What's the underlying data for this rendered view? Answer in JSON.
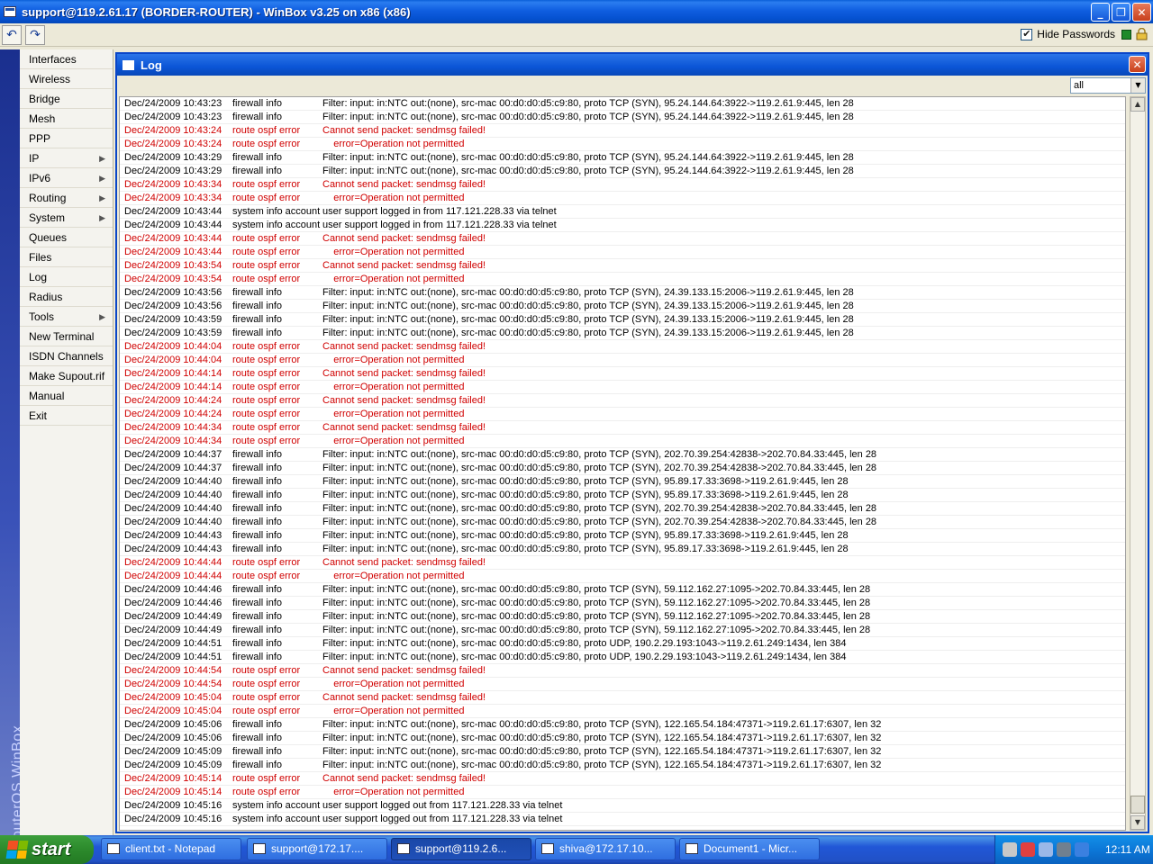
{
  "window": {
    "title": "support@119.2.61.17 (BORDER-ROUTER) - WinBox v3.25 on x86 (x86)"
  },
  "toolbar": {
    "hide_passwords_label": "Hide Passwords",
    "hide_passwords_checked": "✔"
  },
  "sidebar": {
    "brand": "RouterOS WinBox",
    "items": [
      {
        "label": "Interfaces",
        "arrow": ""
      },
      {
        "label": "Wireless",
        "arrow": ""
      },
      {
        "label": "Bridge",
        "arrow": ""
      },
      {
        "label": "Mesh",
        "arrow": ""
      },
      {
        "label": "PPP",
        "arrow": ""
      },
      {
        "label": "IP",
        "arrow": "▶"
      },
      {
        "label": "IPv6",
        "arrow": "▶"
      },
      {
        "label": "Routing",
        "arrow": "▶"
      },
      {
        "label": "System",
        "arrow": "▶"
      },
      {
        "label": "Queues",
        "arrow": ""
      },
      {
        "label": "Files",
        "arrow": ""
      },
      {
        "label": "Log",
        "arrow": ""
      },
      {
        "label": "Radius",
        "arrow": ""
      },
      {
        "label": "Tools",
        "arrow": "▶"
      },
      {
        "label": "New Terminal",
        "arrow": ""
      },
      {
        "label": "ISDN Channels",
        "arrow": ""
      },
      {
        "label": "Make Supout.rif",
        "arrow": ""
      },
      {
        "label": "Manual",
        "arrow": ""
      },
      {
        "label": "Exit",
        "arrow": ""
      }
    ]
  },
  "log_window": {
    "title": "Log",
    "filter_value": "all",
    "rows": [
      {
        "time": "Dec/24/2009 10:43:23",
        "topic": "firewall info",
        "msg": "Filter: input: in:NTC out:(none), src-mac 00:d0:d0:d5:c9:80, proto TCP (SYN), 95.24.144.64:3922->119.2.61.9:445, len 28",
        "err": false
      },
      {
        "time": "Dec/24/2009 10:43:23",
        "topic": "firewall info",
        "msg": "Filter: input: in:NTC out:(none), src-mac 00:d0:d0:d5:c9:80, proto TCP (SYN), 95.24.144.64:3922->119.2.61.9:445, len 28",
        "err": false
      },
      {
        "time": "Dec/24/2009 10:43:24",
        "topic": "route ospf error",
        "msg": "Cannot send packet: sendmsg failed!",
        "err": true
      },
      {
        "time": "Dec/24/2009 10:43:24",
        "topic": "route ospf error",
        "msg": "    error=Operation not permitted",
        "err": true
      },
      {
        "time": "Dec/24/2009 10:43:29",
        "topic": "firewall info",
        "msg": "Filter: input: in:NTC out:(none), src-mac 00:d0:d0:d5:c9:80, proto TCP (SYN), 95.24.144.64:3922->119.2.61.9:445, len 28",
        "err": false
      },
      {
        "time": "Dec/24/2009 10:43:29",
        "topic": "firewall info",
        "msg": "Filter: input: in:NTC out:(none), src-mac 00:d0:d0:d5:c9:80, proto TCP (SYN), 95.24.144.64:3922->119.2.61.9:445, len 28",
        "err": false
      },
      {
        "time": "Dec/24/2009 10:43:34",
        "topic": "route ospf error",
        "msg": "Cannot send packet: sendmsg failed!",
        "err": true
      },
      {
        "time": "Dec/24/2009 10:43:34",
        "topic": "route ospf error",
        "msg": "    error=Operation not permitted",
        "err": true
      },
      {
        "time": "Dec/24/2009 10:43:44",
        "topic": "system info account",
        "msg": "user support logged in from 117.121.228.33 via telnet",
        "err": false
      },
      {
        "time": "Dec/24/2009 10:43:44",
        "topic": "system info account",
        "msg": "user support logged in from 117.121.228.33 via telnet",
        "err": false
      },
      {
        "time": "Dec/24/2009 10:43:44",
        "topic": "route ospf error",
        "msg": "Cannot send packet: sendmsg failed!",
        "err": true
      },
      {
        "time": "Dec/24/2009 10:43:44",
        "topic": "route ospf error",
        "msg": "    error=Operation not permitted",
        "err": true
      },
      {
        "time": "Dec/24/2009 10:43:54",
        "topic": "route ospf error",
        "msg": "Cannot send packet: sendmsg failed!",
        "err": true
      },
      {
        "time": "Dec/24/2009 10:43:54",
        "topic": "route ospf error",
        "msg": "    error=Operation not permitted",
        "err": true
      },
      {
        "time": "Dec/24/2009 10:43:56",
        "topic": "firewall info",
        "msg": "Filter: input: in:NTC out:(none), src-mac 00:d0:d0:d5:c9:80, proto TCP (SYN), 24.39.133.15:2006->119.2.61.9:445, len 28",
        "err": false
      },
      {
        "time": "Dec/24/2009 10:43:56",
        "topic": "firewall info",
        "msg": "Filter: input: in:NTC out:(none), src-mac 00:d0:d0:d5:c9:80, proto TCP (SYN), 24.39.133.15:2006->119.2.61.9:445, len 28",
        "err": false
      },
      {
        "time": "Dec/24/2009 10:43:59",
        "topic": "firewall info",
        "msg": "Filter: input: in:NTC out:(none), src-mac 00:d0:d0:d5:c9:80, proto TCP (SYN), 24.39.133.15:2006->119.2.61.9:445, len 28",
        "err": false
      },
      {
        "time": "Dec/24/2009 10:43:59",
        "topic": "firewall info",
        "msg": "Filter: input: in:NTC out:(none), src-mac 00:d0:d0:d5:c9:80, proto TCP (SYN), 24.39.133.15:2006->119.2.61.9:445, len 28",
        "err": false
      },
      {
        "time": "Dec/24/2009 10:44:04",
        "topic": "route ospf error",
        "msg": "Cannot send packet: sendmsg failed!",
        "err": true
      },
      {
        "time": "Dec/24/2009 10:44:04",
        "topic": "route ospf error",
        "msg": "    error=Operation not permitted",
        "err": true
      },
      {
        "time": "Dec/24/2009 10:44:14",
        "topic": "route ospf error",
        "msg": "Cannot send packet: sendmsg failed!",
        "err": true
      },
      {
        "time": "Dec/24/2009 10:44:14",
        "topic": "route ospf error",
        "msg": "    error=Operation not permitted",
        "err": true
      },
      {
        "time": "Dec/24/2009 10:44:24",
        "topic": "route ospf error",
        "msg": "Cannot send packet: sendmsg failed!",
        "err": true
      },
      {
        "time": "Dec/24/2009 10:44:24",
        "topic": "route ospf error",
        "msg": "    error=Operation not permitted",
        "err": true
      },
      {
        "time": "Dec/24/2009 10:44:34",
        "topic": "route ospf error",
        "msg": "Cannot send packet: sendmsg failed!",
        "err": true
      },
      {
        "time": "Dec/24/2009 10:44:34",
        "topic": "route ospf error",
        "msg": "    error=Operation not permitted",
        "err": true
      },
      {
        "time": "Dec/24/2009 10:44:37",
        "topic": "firewall info",
        "msg": "Filter: input: in:NTC out:(none), src-mac 00:d0:d0:d5:c9:80, proto TCP (SYN), 202.70.39.254:42838->202.70.84.33:445, len 28",
        "err": false
      },
      {
        "time": "Dec/24/2009 10:44:37",
        "topic": "firewall info",
        "msg": "Filter: input: in:NTC out:(none), src-mac 00:d0:d0:d5:c9:80, proto TCP (SYN), 202.70.39.254:42838->202.70.84.33:445, len 28",
        "err": false
      },
      {
        "time": "Dec/24/2009 10:44:40",
        "topic": "firewall info",
        "msg": "Filter: input: in:NTC out:(none), src-mac 00:d0:d0:d5:c9:80, proto TCP (SYN), 95.89.17.33:3698->119.2.61.9:445, len 28",
        "err": false
      },
      {
        "time": "Dec/24/2009 10:44:40",
        "topic": "firewall info",
        "msg": "Filter: input: in:NTC out:(none), src-mac 00:d0:d0:d5:c9:80, proto TCP (SYN), 95.89.17.33:3698->119.2.61.9:445, len 28",
        "err": false
      },
      {
        "time": "Dec/24/2009 10:44:40",
        "topic": "firewall info",
        "msg": "Filter: input: in:NTC out:(none), src-mac 00:d0:d0:d5:c9:80, proto TCP (SYN), 202.70.39.254:42838->202.70.84.33:445, len 28",
        "err": false
      },
      {
        "time": "Dec/24/2009 10:44:40",
        "topic": "firewall info",
        "msg": "Filter: input: in:NTC out:(none), src-mac 00:d0:d0:d5:c9:80, proto TCP (SYN), 202.70.39.254:42838->202.70.84.33:445, len 28",
        "err": false
      },
      {
        "time": "Dec/24/2009 10:44:43",
        "topic": "firewall info",
        "msg": "Filter: input: in:NTC out:(none), src-mac 00:d0:d0:d5:c9:80, proto TCP (SYN), 95.89.17.33:3698->119.2.61.9:445, len 28",
        "err": false
      },
      {
        "time": "Dec/24/2009 10:44:43",
        "topic": "firewall info",
        "msg": "Filter: input: in:NTC out:(none), src-mac 00:d0:d0:d5:c9:80, proto TCP (SYN), 95.89.17.33:3698->119.2.61.9:445, len 28",
        "err": false
      },
      {
        "time": "Dec/24/2009 10:44:44",
        "topic": "route ospf error",
        "msg": "Cannot send packet: sendmsg failed!",
        "err": true
      },
      {
        "time": "Dec/24/2009 10:44:44",
        "topic": "route ospf error",
        "msg": "    error=Operation not permitted",
        "err": true
      },
      {
        "time": "Dec/24/2009 10:44:46",
        "topic": "firewall info",
        "msg": "Filter: input: in:NTC out:(none), src-mac 00:d0:d0:d5:c9:80, proto TCP (SYN), 59.112.162.27:1095->202.70.84.33:445, len 28",
        "err": false
      },
      {
        "time": "Dec/24/2009 10:44:46",
        "topic": "firewall info",
        "msg": "Filter: input: in:NTC out:(none), src-mac 00:d0:d0:d5:c9:80, proto TCP (SYN), 59.112.162.27:1095->202.70.84.33:445, len 28",
        "err": false
      },
      {
        "time": "Dec/24/2009 10:44:49",
        "topic": "firewall info",
        "msg": "Filter: input: in:NTC out:(none), src-mac 00:d0:d0:d5:c9:80, proto TCP (SYN), 59.112.162.27:1095->202.70.84.33:445, len 28",
        "err": false
      },
      {
        "time": "Dec/24/2009 10:44:49",
        "topic": "firewall info",
        "msg": "Filter: input: in:NTC out:(none), src-mac 00:d0:d0:d5:c9:80, proto TCP (SYN), 59.112.162.27:1095->202.70.84.33:445, len 28",
        "err": false
      },
      {
        "time": "Dec/24/2009 10:44:51",
        "topic": "firewall info",
        "msg": "Filter: input: in:NTC out:(none), src-mac 00:d0:d0:d5:c9:80, proto UDP, 190.2.29.193:1043->119.2.61.249:1434, len 384",
        "err": false
      },
      {
        "time": "Dec/24/2009 10:44:51",
        "topic": "firewall info",
        "msg": "Filter: input: in:NTC out:(none), src-mac 00:d0:d0:d5:c9:80, proto UDP, 190.2.29.193:1043->119.2.61.249:1434, len 384",
        "err": false
      },
      {
        "time": "Dec/24/2009 10:44:54",
        "topic": "route ospf error",
        "msg": "Cannot send packet: sendmsg failed!",
        "err": true
      },
      {
        "time": "Dec/24/2009 10:44:54",
        "topic": "route ospf error",
        "msg": "    error=Operation not permitted",
        "err": true
      },
      {
        "time": "Dec/24/2009 10:45:04",
        "topic": "route ospf error",
        "msg": "Cannot send packet: sendmsg failed!",
        "err": true
      },
      {
        "time": "Dec/24/2009 10:45:04",
        "topic": "route ospf error",
        "msg": "    error=Operation not permitted",
        "err": true
      },
      {
        "time": "Dec/24/2009 10:45:06",
        "topic": "firewall info",
        "msg": "Filter: input: in:NTC out:(none), src-mac 00:d0:d0:d5:c9:80, proto TCP (SYN), 122.165.54.184:47371->119.2.61.17:6307, len 32",
        "err": false
      },
      {
        "time": "Dec/24/2009 10:45:06",
        "topic": "firewall info",
        "msg": "Filter: input: in:NTC out:(none), src-mac 00:d0:d0:d5:c9:80, proto TCP (SYN), 122.165.54.184:47371->119.2.61.17:6307, len 32",
        "err": false
      },
      {
        "time": "Dec/24/2009 10:45:09",
        "topic": "firewall info",
        "msg": "Filter: input: in:NTC out:(none), src-mac 00:d0:d0:d5:c9:80, proto TCP (SYN), 122.165.54.184:47371->119.2.61.17:6307, len 32",
        "err": false
      },
      {
        "time": "Dec/24/2009 10:45:09",
        "topic": "firewall info",
        "msg": "Filter: input: in:NTC out:(none), src-mac 00:d0:d0:d5:c9:80, proto TCP (SYN), 122.165.54.184:47371->119.2.61.17:6307, len 32",
        "err": false
      },
      {
        "time": "Dec/24/2009 10:45:14",
        "topic": "route ospf error",
        "msg": "Cannot send packet: sendmsg failed!",
        "err": true
      },
      {
        "time": "Dec/24/2009 10:45:14",
        "topic": "route ospf error",
        "msg": "    error=Operation not permitted",
        "err": true
      },
      {
        "time": "Dec/24/2009 10:45:16",
        "topic": "system info account",
        "msg": "user support logged out from 117.121.228.33 via telnet",
        "err": false
      },
      {
        "time": "Dec/24/2009 10:45:16",
        "topic": "system info account",
        "msg": "user support logged out from 117.121.228.33 via telnet",
        "err": false
      }
    ]
  },
  "taskbar": {
    "start_label": "start",
    "tasks": [
      {
        "label": "client.txt - Notepad",
        "active": false
      },
      {
        "label": "support@172.17....",
        "active": false
      },
      {
        "label": "support@119.2.6...",
        "active": true
      },
      {
        "label": "shiva@172.17.10...",
        "active": false
      },
      {
        "label": "Document1 - Micr...",
        "active": false
      }
    ],
    "clock": "12:11 AM"
  },
  "colors": {
    "error_text": "#d00000",
    "title_blue": "#0b55d6"
  }
}
